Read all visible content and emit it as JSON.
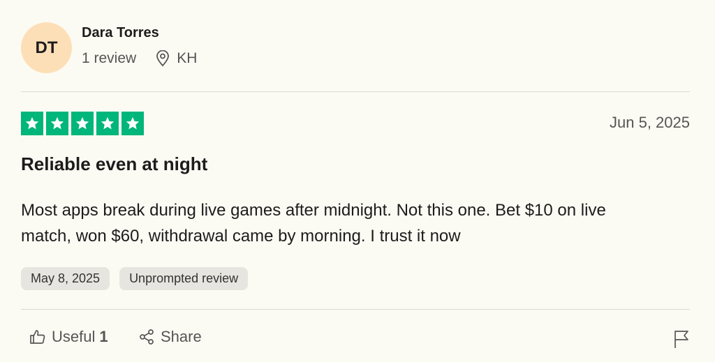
{
  "reviewer": {
    "initials": "DT",
    "name": "Dara Torres",
    "review_count": "1 review",
    "country": "KH",
    "avatar_color": "#fddfb7"
  },
  "review": {
    "rating": 5,
    "rating_color": "#00b67a",
    "date": "Jun 5, 2025",
    "title": "Reliable even at night",
    "body": "Most apps break during live games after midnight. Not this one. Bet $10 on live match, won $60, withdrawal came by morning. I trust it now",
    "tags": {
      "experience_date": "May 8, 2025",
      "type": "Unprompted review"
    }
  },
  "actions": {
    "useful_label": "Useful",
    "useful_count": "1",
    "share_label": "Share",
    "useful_icon": "thumbs-up-icon",
    "share_icon": "share-icon",
    "report_icon": "flag-icon"
  }
}
